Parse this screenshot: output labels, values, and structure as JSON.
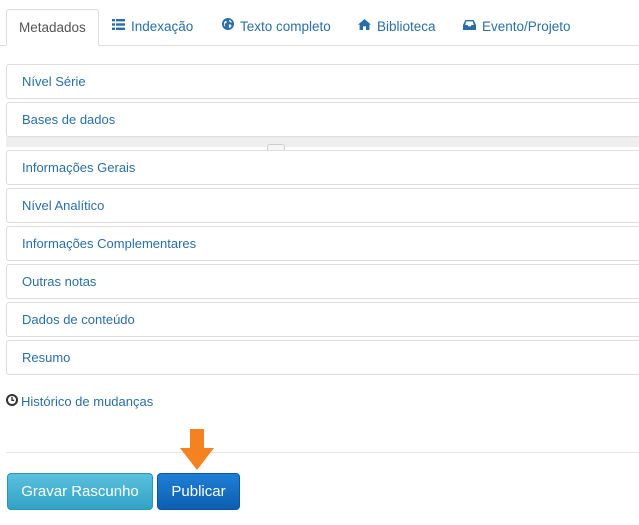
{
  "tabs": [
    {
      "label": "Metadados",
      "icon": "none",
      "active": true
    },
    {
      "label": "Indexação",
      "icon": "list-icon",
      "active": false
    },
    {
      "label": "Texto completo",
      "icon": "globe-icon",
      "active": false
    },
    {
      "label": "Biblioteca",
      "icon": "home-icon",
      "active": false
    },
    {
      "label": "Evento/Projeto",
      "icon": "inbox-icon",
      "active": false
    }
  ],
  "panels": [
    {
      "title": "Nível Série"
    },
    {
      "title": "Bases de dados"
    },
    {
      "title": "Informações Gerais"
    },
    {
      "title": "Nível Analítico"
    },
    {
      "title": "Informações Complementares"
    },
    {
      "title": "Outras notas"
    },
    {
      "title": "Dados de conteúdo"
    },
    {
      "title": "Resumo"
    }
  ],
  "history": {
    "label": "Histórico de mudanças",
    "icon": "clock-icon"
  },
  "actions": {
    "draft_label": "Gravar Rascunho",
    "publish_label": "Publicar"
  },
  "colors": {
    "link": "#2a6ea6",
    "draft_button": "#46b8da",
    "publish_button": "#1167be",
    "arrow": "#f58220"
  }
}
